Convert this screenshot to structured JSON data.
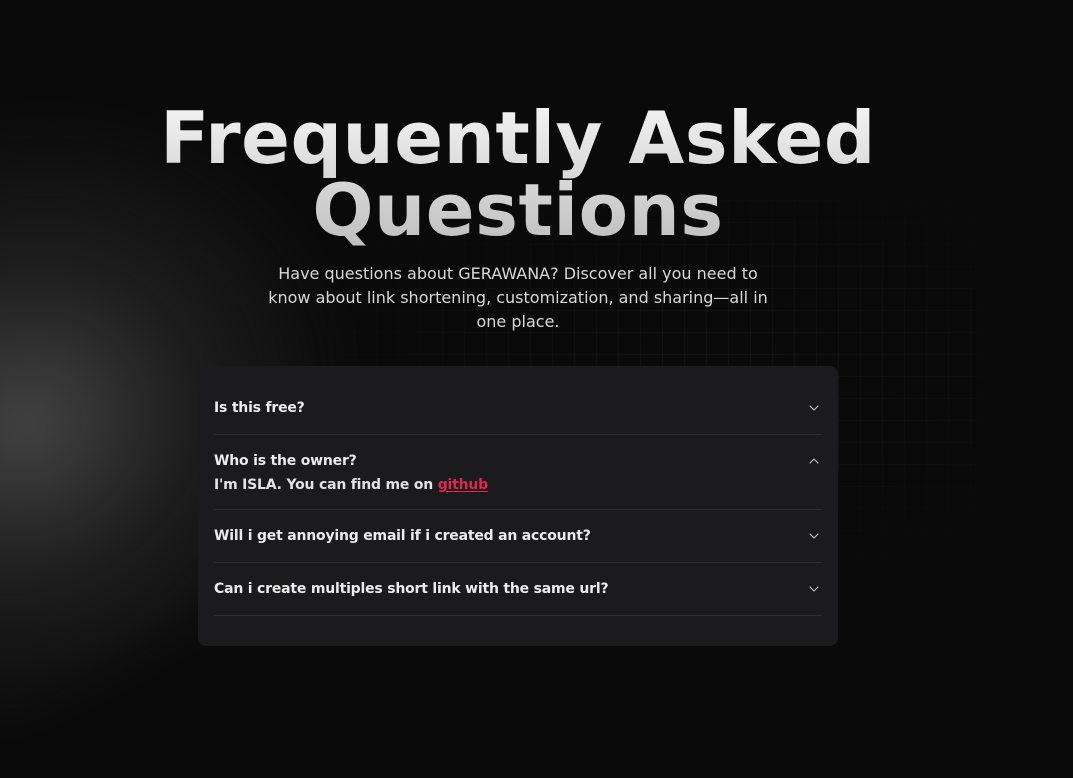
{
  "hero": {
    "title_line1": "Frequently Asked",
    "title_line2": "Questions",
    "subtitle": "Have questions about GERAWANA? Discover all you need to know about link shortening, customization, and sharing—all in one place."
  },
  "faq": {
    "items": [
      {
        "question": "Is this free?",
        "expanded": false
      },
      {
        "question": "Who is the owner?",
        "expanded": true,
        "answer_prefix": "I'm ISLA. You can find me on ",
        "answer_link": "github"
      },
      {
        "question": "Will i get annoying email if i created an account?",
        "expanded": false
      },
      {
        "question": "Can i create multiples short link with the same url?",
        "expanded": false
      }
    ]
  },
  "icons": {
    "collapsed": "chevron-down-icon",
    "expanded": "chevron-up-icon"
  },
  "colors": {
    "background": "#0b0a0a",
    "card": "#1b1b1d",
    "link": "#e0254f",
    "divider": "#2d2d30"
  }
}
